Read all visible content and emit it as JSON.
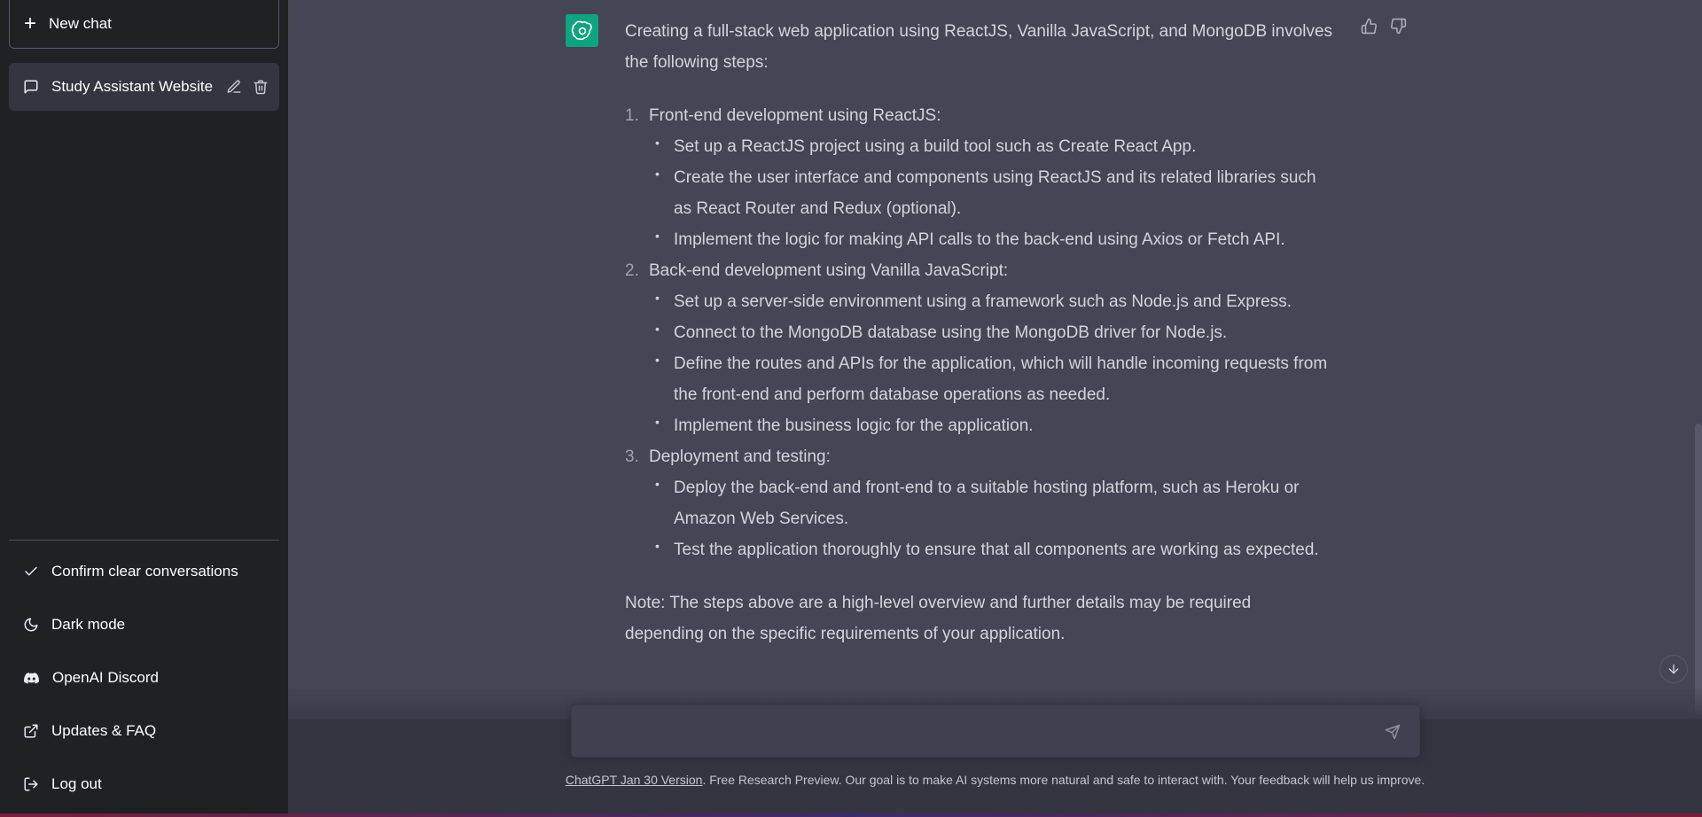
{
  "sidebar": {
    "new_chat_label": "New chat",
    "conversation_title": "Study Assistant Website",
    "menu": [
      {
        "label": "Confirm clear conversations",
        "icon": "check-icon"
      },
      {
        "label": "Dark mode",
        "icon": "moon-icon"
      },
      {
        "label": "OpenAI Discord",
        "icon": "discord-icon"
      },
      {
        "label": "Updates & FAQ",
        "icon": "external-link-icon"
      },
      {
        "label": "Log out",
        "icon": "logout-icon"
      }
    ]
  },
  "message": {
    "intro": "Creating a full-stack web application using ReactJS, Vanilla JavaScript, and MongoDB involves the following steps:",
    "steps": [
      {
        "number": "1.",
        "title": "Front-end development using ReactJS:",
        "items": [
          "Set up a ReactJS project using a build tool such as Create React App.",
          "Create the user interface and components using ReactJS and its related libraries such as React Router and Redux (optional).",
          "Implement the logic for making API calls to the back-end using Axios or Fetch API."
        ]
      },
      {
        "number": "2.",
        "title": "Back-end development using Vanilla JavaScript:",
        "items": [
          "Set up a server-side environment using a framework such as Node.js and Express.",
          "Connect to the MongoDB database using the MongoDB driver for Node.js.",
          "Define the routes and APIs for the application, which will handle incoming requests from the front-end and perform database operations as needed.",
          "Implement the business logic for the application."
        ]
      },
      {
        "number": "3.",
        "title": "Deployment and testing:",
        "items": [
          "Deploy the back-end and front-end to a suitable hosting platform, such as Heroku or Amazon Web Services.",
          "Test the application thoroughly to ensure that all components are working as expected."
        ]
      }
    ],
    "note": "Note: The steps above are a high-level overview and further details may be required depending on the specific requirements of your application."
  },
  "composer": {
    "placeholder": ""
  },
  "footer": {
    "version_link": "ChatGPT Jan 30 Version",
    "text": ". Free Research Preview. Our goal is to make AI systems more natural and safe to interact with. Your feedback will help us improve."
  },
  "colors": {
    "sidebar_bg": "#202123",
    "main_bg": "#444654",
    "avatar_bg": "#10a37f",
    "input_bg": "#40414f"
  }
}
